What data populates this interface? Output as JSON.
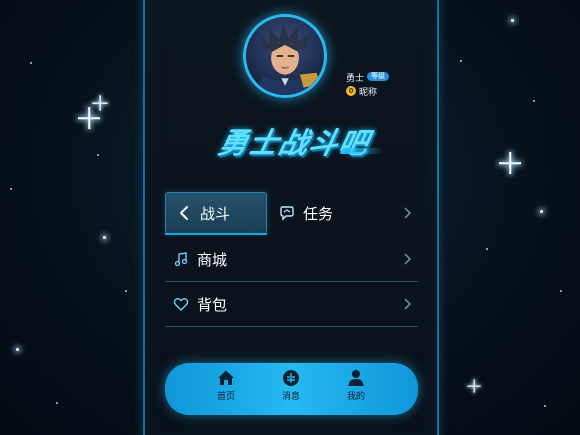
{
  "profile": {
    "name": "勇士",
    "level_badge": "等级",
    "coin_symbol": "0",
    "nickname": "昵称"
  },
  "game_title": "勇士战斗吧",
  "menu": {
    "fight": "战斗",
    "task": "任务",
    "shop": "商城",
    "bag": "背包"
  },
  "bottom_nav": {
    "home": "首页",
    "messages": "消息",
    "mine": "我的"
  },
  "colors": {
    "accent": "#2ab8ee",
    "nav_bar": "#26b9f2",
    "title": "#5fe2ff"
  },
  "icons": {
    "fight": "chevron-left-icon",
    "task": "chat-bubble-icon",
    "shop": "music-note-icon",
    "bag": "heart-icon",
    "home": "home-icon",
    "messages": "message-circle-icon",
    "mine": "user-icon"
  }
}
